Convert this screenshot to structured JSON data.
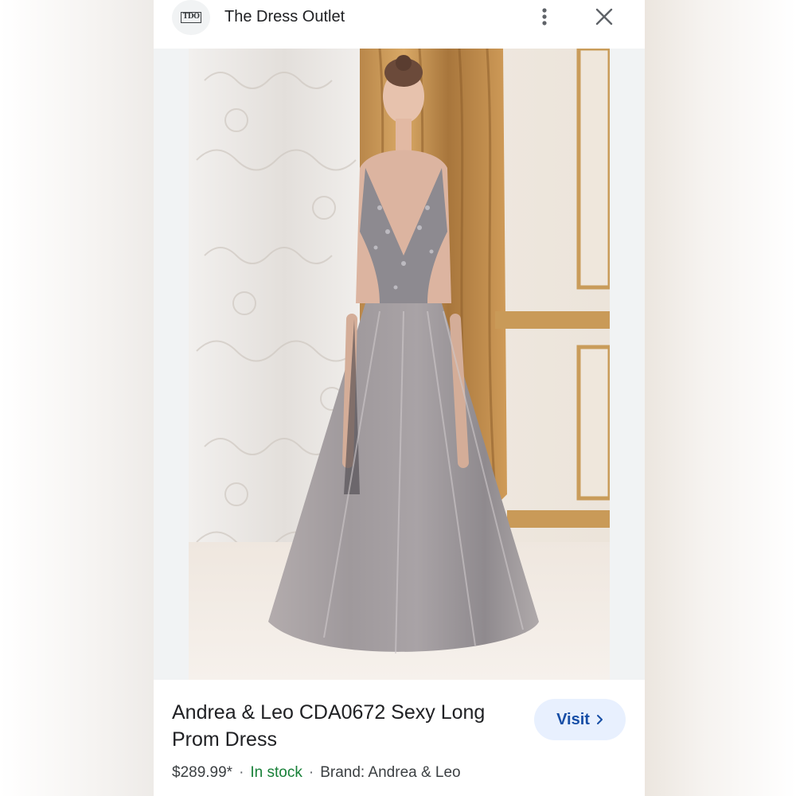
{
  "header": {
    "logo_text": "TDO",
    "site_name": "The Dress Outlet",
    "menu_icon": "more-vert-icon",
    "close_icon": "close-icon"
  },
  "product": {
    "title": "Andrea & Leo CDA0672 Sexy Long Prom Dress",
    "price": "$289.99*",
    "separator": "·",
    "availability": "In stock",
    "brand": "Brand: Andrea & Leo"
  },
  "visit_button": {
    "label": "Visit",
    "icon": "chevron-right-icon"
  },
  "colors": {
    "visit_bg": "#e8f0fe",
    "visit_text": "#174ea6",
    "in_stock": "#188038",
    "card_bg": "#f1f3f4"
  }
}
